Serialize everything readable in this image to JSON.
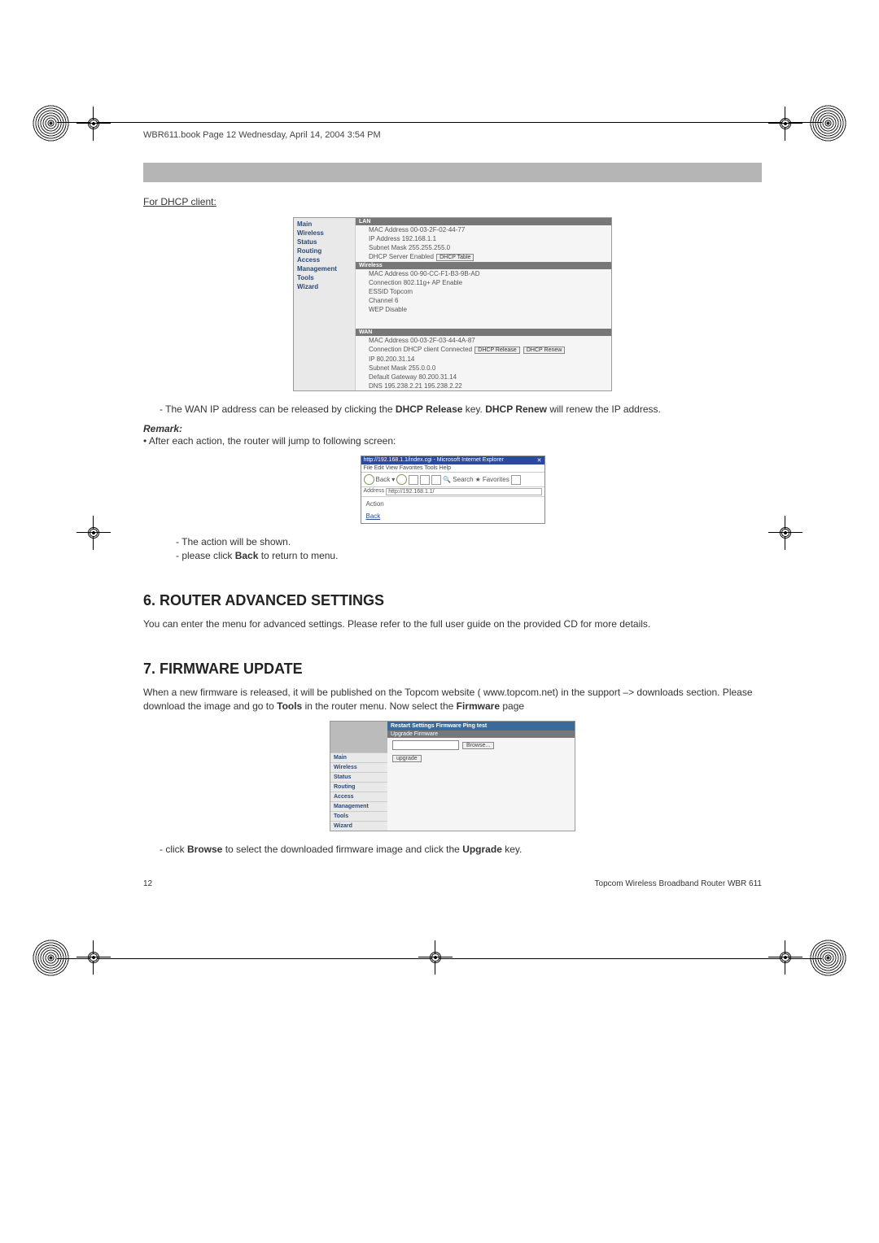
{
  "header": "WBR611.book  Page 12  Wednesday, April 14, 2004  3:54 PM",
  "dhcp_label": "For DHCP client:",
  "fig1": {
    "nav": [
      "Main",
      "Wireless",
      "Status",
      "Routing",
      "Access",
      "Management",
      "Tools",
      "Wizard"
    ],
    "lan_band": "LAN",
    "lan_lines": [
      "MAC Address 00-03-2F-02-44-77",
      "IP Address 192.168.1.1",
      "Subnet Mask 255.255.255.0",
      "DHCP Server Enabled"
    ],
    "lan_btn": "DHCP Table",
    "wlan_band": "Wireless",
    "wlan_lines": [
      "MAC Address 00-90-CC-F1-B3-9B-AD",
      "Connection 802.11g+ AP Enable",
      "ESSID Topcom",
      "Channel 6",
      "WEP Disable"
    ],
    "wan_band": "WAN",
    "wan_mac": "MAC Address 00-03-2F-03-44-4A-87",
    "wan_conn": "Connection DHCP client Connected",
    "wan_btn1": "DHCP Release",
    "wan_btn2": "DHCP Renew",
    "wan_lines": [
      "IP 80.200.31.14",
      "Subnet Mask 255.0.0.0",
      "Default Gateway 80.200.31.14",
      "DNS 195.238.2.21 195.238.2.22"
    ]
  },
  "wan_text_prefix": "- The WAN IP address can be released by clicking the ",
  "wan_text_b1": "DHCP Release",
  "wan_text_mid": " key. ",
  "wan_text_b2": "DHCP Renew",
  "wan_text_suffix": " will renew the IP address.",
  "remark_label": "Remark:",
  "remark_bullet": "•   After each action, the router will jump to following screen:",
  "fig2": {
    "title": "http://192.168.1.1/index.cgi - Microsoft Internet Explorer",
    "menu": "File   Edit   View   Favorites   Tools   Help",
    "toolbar_back": "Back",
    "toolbar_search": "Search",
    "toolbar_fav": "Favorites",
    "addr_label": "Address",
    "addr_value": "http://192.168.1.1/",
    "body_action": "Action",
    "body_back": "Back"
  },
  "after_fig2_l1": "- The action will be shown.",
  "after_fig2_l2_a": "- please click ",
  "after_fig2_l2_b": "Back",
  "after_fig2_l2_c": " to return to menu.",
  "sec6_title": "6.  ROUTER ADVANCED SETTINGS",
  "sec6_text": "You can enter the menu for advanced settings. Please refer to the full user guide on the provided CD for more details.",
  "sec7_title": "7.  FIRMWARE UPDATE",
  "sec7_text_a": "When a new firmware is released, it will be published on the Topcom website ( www.topcom.net) in the support –> downloads section. Please download the image and go to ",
  "sec7_text_b": "Tools",
  "sec7_text_c": " in the router menu. Now select the ",
  "sec7_text_d": "Firmware",
  "sec7_text_e": " page",
  "fig3": {
    "nav": [
      "Main",
      "Wireless",
      "Status",
      "Routing",
      "Access",
      "Management",
      "Tools",
      "Wizard"
    ],
    "band": "Restart   Settings   Firmware   Ping test",
    "sub": "Upgrade Firmware",
    "browse": "Browse...",
    "upgrade": "upgrade"
  },
  "after_fig3_a": "- click ",
  "after_fig3_b": "Browse",
  "after_fig3_c": " to select the downloaded firmware image and click the ",
  "after_fig3_d": "Upgrade",
  "after_fig3_e": " key.",
  "footer_left": "12",
  "footer_right": "Topcom Wireless Broadband Router WBR 611"
}
